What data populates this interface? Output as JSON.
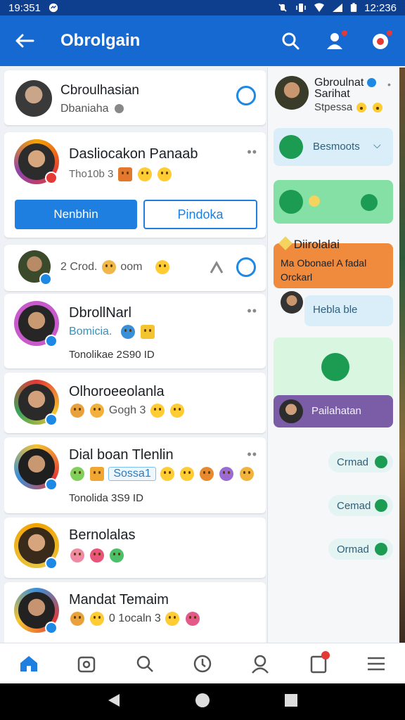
{
  "status_bar": {
    "time_left": "19:351",
    "time_right": "12:236"
  },
  "app_bar": {
    "title": "Obrolgain"
  },
  "chats": [
    {
      "name": "Cbroulhasian",
      "sub": "Dbaniaha"
    },
    {
      "name": "Dasliocakon Panaab",
      "sub": "Tho10b 3",
      "primary_btn": "Nenbhin",
      "secondary_btn": "Pindoka"
    },
    {
      "sub": "2  Crod.",
      "sub2": "oom"
    },
    {
      "name": "DbrollNarl",
      "tag": "Bomicia.",
      "sub": "Tonolikae 2S90 ID"
    },
    {
      "name": "Olhoroeeolanla",
      "sub": "Gogh 3"
    },
    {
      "name": "Dial boan Tlenlin",
      "tag": "Sossa1",
      "sub": "Tonolida 3S9 ID"
    },
    {
      "name": "Bernolalas"
    },
    {
      "name": "Mandat Temaim",
      "sub": "0 1ocaln 3"
    }
  ],
  "side_panel": {
    "profile_name_1": "Gbroulnat",
    "profile_name_2": "Sarihat",
    "profile_sub": "Stpessa",
    "bubble1": "Besmoots",
    "orange_title": "Diirolalai",
    "orange_text": "Ma Obonael A fadal Orckarl",
    "reply": "Hebla ble",
    "purple_label": "Pailahatan",
    "pills": [
      "Crmad",
      "Cemad",
      "Ormad"
    ]
  },
  "colors": {
    "primary": "#1669d1",
    "accent": "#1e7fe0",
    "green": "#1b9c52",
    "orange": "#f08a3c",
    "purple": "#7b5ca6"
  }
}
